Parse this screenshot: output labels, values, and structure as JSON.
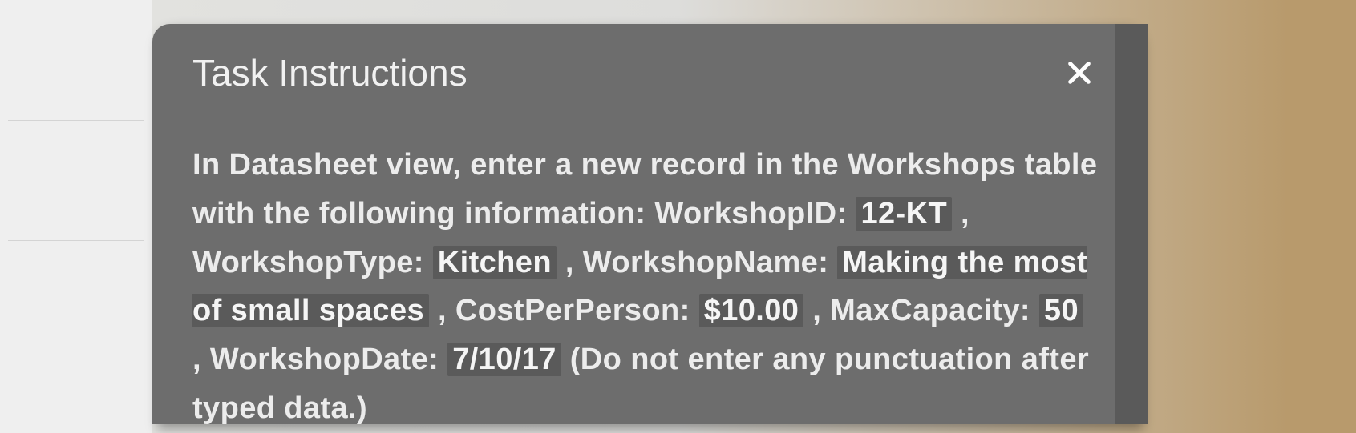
{
  "modal": {
    "title": "Task Instructions",
    "body_prefix": "In Datasheet view, enter a new record in the Workshops table with the following information: WorkshopID: ",
    "workshop_id": "12-KT",
    "sep1": " , WorkshopType: ",
    "workshop_type": "Kitchen",
    "sep2": " , WorkshopName: ",
    "workshop_name": "Making the most of small spaces",
    "sep3": " , CostPerPerson: ",
    "cost_per_person": "$10.00",
    "sep4": " , MaxCapacity: ",
    "max_capacity": "50",
    "sep5": " , WorkshopDate: ",
    "workshop_date": "7/10/17",
    "body_suffix": "  (Do not enter any punctuation after typed data.)"
  }
}
